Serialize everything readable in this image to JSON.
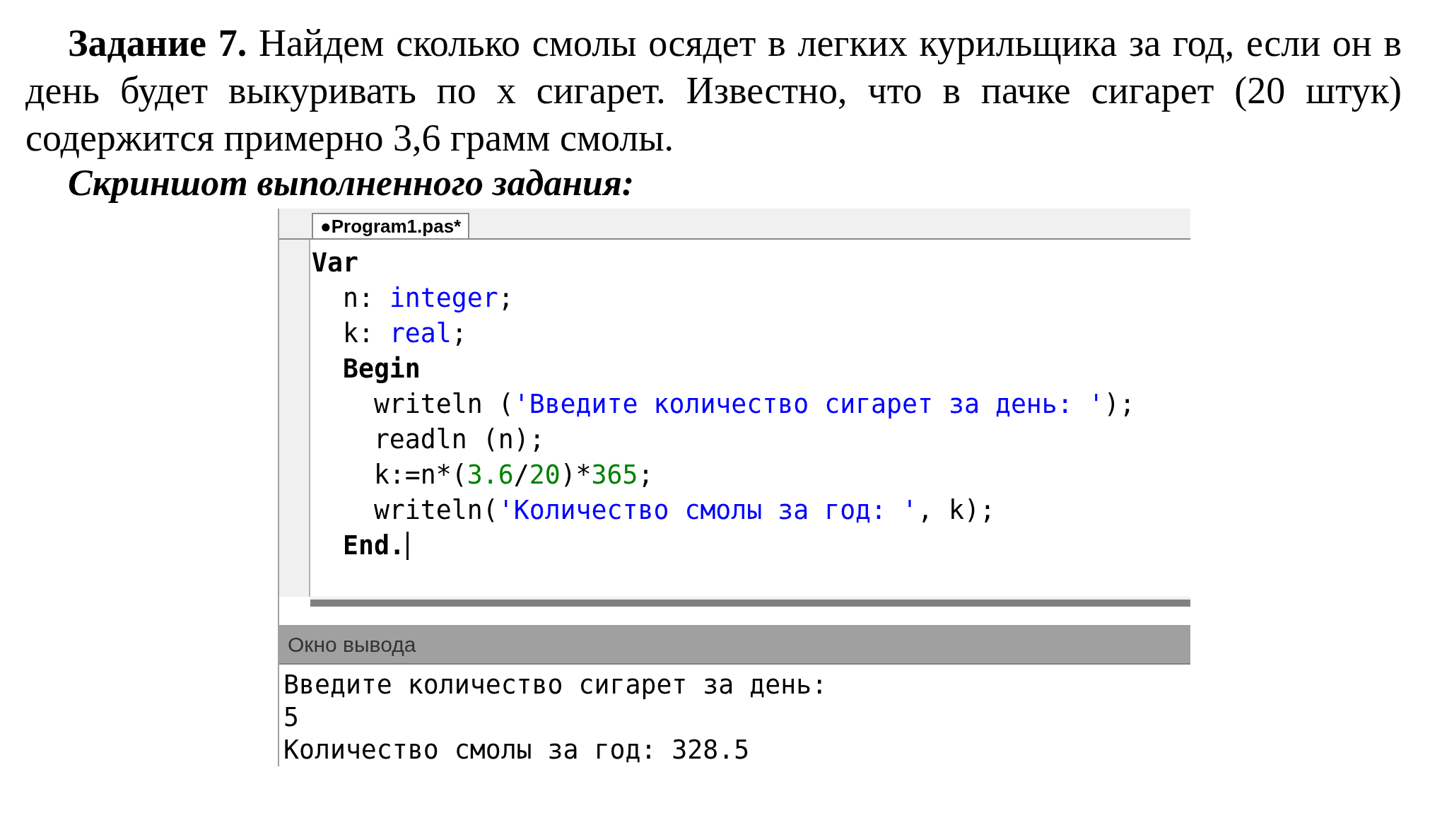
{
  "task": {
    "text": "**Задание 7.** Найдем сколько смолы осядет в легких курильщика за год, если он в день будет выкуривать по x сигарет. Известно, что в пачке сигарет (20 штук) содержится примерно 3,6 грамм смолы."
  },
  "subtitle": "Скриншот выполненного задания:",
  "editor": {
    "tabs": [
      {
        "label": "●Program1.pas*",
        "selected": true
      }
    ],
    "lines": [
      {
        "cursor": false,
        "tokens": [
          {
            "kind": "keyword",
            "text": "Var"
          }
        ]
      },
      {
        "cursor": false,
        "tokens": [
          {
            "kind": "plain",
            "text": "  n: "
          },
          {
            "kind": "type",
            "text": "integer"
          },
          {
            "kind": "plain",
            "text": ";"
          }
        ]
      },
      {
        "cursor": false,
        "tokens": [
          {
            "kind": "plain",
            "text": "  k: "
          },
          {
            "kind": "type",
            "text": "real"
          },
          {
            "kind": "plain",
            "text": ";"
          }
        ]
      },
      {
        "cursor": false,
        "tokens": [
          {
            "kind": "keyword",
            "text": "  Begin"
          }
        ]
      },
      {
        "cursor": false,
        "tokens": [
          {
            "kind": "plain",
            "text": "    writeln ("
          },
          {
            "kind": "string",
            "text": "'Введите количество сигарет за день: '"
          },
          {
            "kind": "plain",
            "text": ");"
          }
        ]
      },
      {
        "cursor": false,
        "tokens": [
          {
            "kind": "plain",
            "text": "    readln (n);"
          }
        ]
      },
      {
        "cursor": false,
        "tokens": [
          {
            "kind": "plain",
            "text": "    k:=n*("
          },
          {
            "kind": "number",
            "text": "3.6"
          },
          {
            "kind": "plain",
            "text": "/"
          },
          {
            "kind": "number",
            "text": "20"
          },
          {
            "kind": "plain",
            "text": ")*"
          },
          {
            "kind": "number",
            "text": "365"
          },
          {
            "kind": "plain",
            "text": ";"
          }
        ]
      },
      {
        "cursor": false,
        "tokens": [
          {
            "kind": "plain",
            "text": "    writeln("
          },
          {
            "kind": "string",
            "text": "'Количество смолы за год: '"
          },
          {
            "kind": "plain",
            "text": ", k);"
          }
        ]
      },
      {
        "cursor": true,
        "tokens": [
          {
            "kind": "keyword",
            "text": "  End."
          }
        ]
      }
    ]
  },
  "output": {
    "title": "Окно вывода",
    "lines": [
      "Введите количество сигарет за день:",
      "5",
      "Количество смолы за год: 328.5"
    ]
  }
}
